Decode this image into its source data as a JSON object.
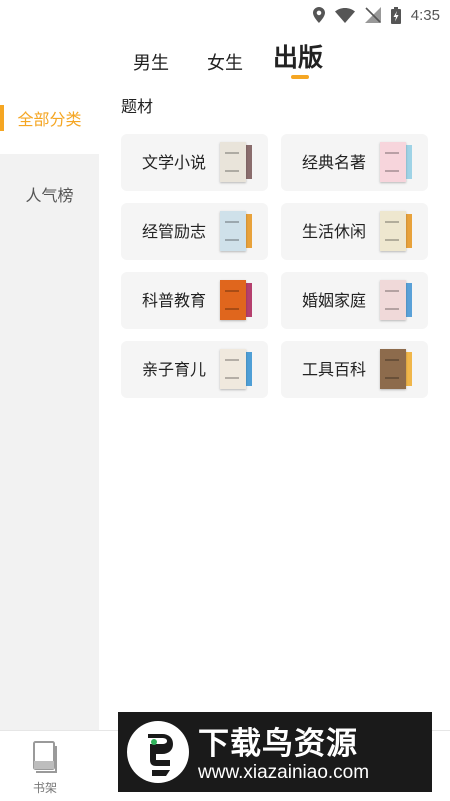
{
  "status_bar": {
    "time": "4:35",
    "icons": [
      "location-icon",
      "wifi-icon",
      "no-signal-icon",
      "battery-charging-icon"
    ]
  },
  "tabs": [
    {
      "label": "男生",
      "active": false
    },
    {
      "label": "女生",
      "active": false
    },
    {
      "label": "出版",
      "active": true
    }
  ],
  "sidebar": {
    "items": [
      {
        "label": "全部分类",
        "active": true
      },
      {
        "label": "人气榜",
        "active": false
      }
    ]
  },
  "content": {
    "section_title": "题材",
    "categories": [
      {
        "label": "文学小说",
        "cover_color": "#e9e4da",
        "back_color": "#8a6d6d",
        "icon": "book-cover-icon"
      },
      {
        "label": "经典名著",
        "cover_color": "#f7d5dc",
        "back_color": "#9fd3e6",
        "icon": "book-cover-icon"
      },
      {
        "label": "经管励志",
        "cover_color": "#cfe1ea",
        "back_color": "#e8a23b",
        "icon": "book-cover-icon"
      },
      {
        "label": "生活休闲",
        "cover_color": "#eee7cf",
        "back_color": "#e8a23b",
        "icon": "book-cover-icon"
      },
      {
        "label": "科普教育",
        "cover_color": "#e0661d",
        "back_color": "#b5406e",
        "icon": "book-cover-icon"
      },
      {
        "label": "婚姻家庭",
        "cover_color": "#f0d9d9",
        "back_color": "#5aa1d8",
        "icon": "book-cover-icon"
      },
      {
        "label": "亲子育儿",
        "cover_color": "#f0e9de",
        "back_color": "#4f9fd6",
        "icon": "book-cover-icon"
      },
      {
        "label": "工具百科",
        "cover_color": "#8d6b4c",
        "back_color": "#f0b64a",
        "icon": "book-cover-icon"
      }
    ]
  },
  "bottom_nav": {
    "shelf_label": "书架",
    "icon": "bookshelf-icon"
  },
  "watermark": {
    "title": "下载鸟资源",
    "url": "www.xiazainiao.com"
  },
  "colors": {
    "accent": "#f5a623",
    "card_bg": "#f5f5f5",
    "sidebar_bg": "#f2f2f2"
  }
}
